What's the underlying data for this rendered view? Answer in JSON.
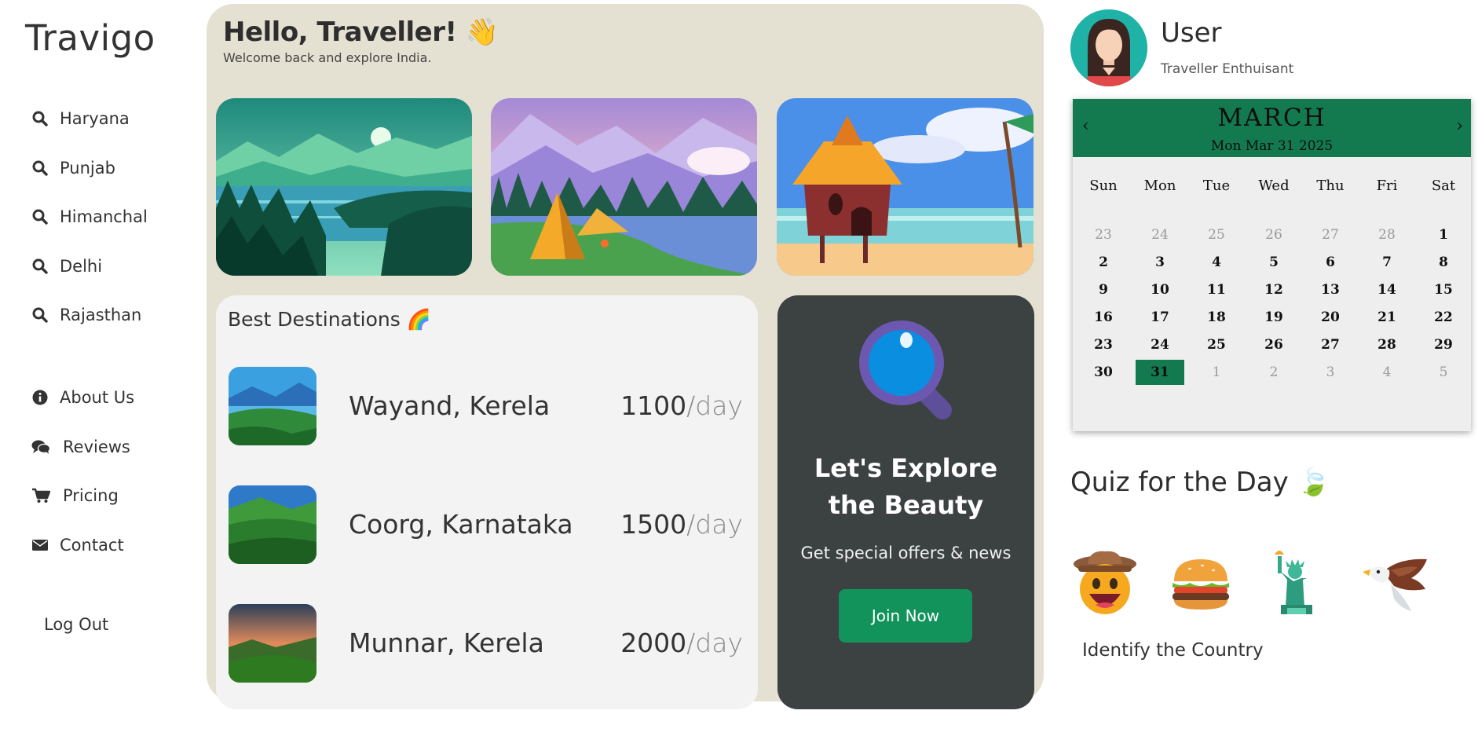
{
  "brand": "Travigo",
  "sidebar": {
    "destinations": [
      {
        "label": "Haryana",
        "icon": "search-icon"
      },
      {
        "label": "Punjab",
        "icon": "search-icon"
      },
      {
        "label": "Himanchal",
        "icon": "search-icon"
      },
      {
        "label": "Delhi",
        "icon": "search-icon"
      },
      {
        "label": "Rajasthan",
        "icon": "search-icon"
      }
    ],
    "links": [
      {
        "label": "About Us",
        "icon": "info-icon"
      },
      {
        "label": "Reviews",
        "icon": "comments-icon"
      },
      {
        "label": "Pricing",
        "icon": "cart-icon"
      },
      {
        "label": "Contact",
        "icon": "envelope-icon"
      }
    ],
    "logout": "Log Out"
  },
  "header": {
    "greeting": "Hello, Traveller! 👋",
    "subtitle": "Welcome back and explore India."
  },
  "best": {
    "title": "Best Destinations 🌈",
    "items": [
      {
        "name": "Wayand, Kerela",
        "price": "1100",
        "unit": "/day"
      },
      {
        "name": "Coorg, Karnataka",
        "price": "1500",
        "unit": "/day"
      },
      {
        "name": "Munnar, Kerela",
        "price": "2000",
        "unit": "/day"
      }
    ]
  },
  "explore": {
    "title_line1": "Let's Explore",
    "title_line2": "the Beauty",
    "text": "Get special offers & news",
    "button": "Join Now"
  },
  "user": {
    "name": "User",
    "role": "Traveller Enthuisant"
  },
  "calendar": {
    "month": "MARCH",
    "date": "Mon Mar 31 2025",
    "prev": "‹",
    "next": "›",
    "weekdays": [
      "Sun",
      "Mon",
      "Tue",
      "Wed",
      "Thu",
      "Fri",
      "Sat"
    ],
    "selected_day": 31,
    "weeks": [
      [
        {
          "d": "23",
          "m": true
        },
        {
          "d": "24",
          "m": true
        },
        {
          "d": "25",
          "m": true
        },
        {
          "d": "26",
          "m": true
        },
        {
          "d": "27",
          "m": true
        },
        {
          "d": "28",
          "m": true
        },
        {
          "d": "1"
        }
      ],
      [
        {
          "d": "2"
        },
        {
          "d": "3"
        },
        {
          "d": "4"
        },
        {
          "d": "5"
        },
        {
          "d": "6"
        },
        {
          "d": "7"
        },
        {
          "d": "8"
        }
      ],
      [
        {
          "d": "9"
        },
        {
          "d": "10"
        },
        {
          "d": "11"
        },
        {
          "d": "12"
        },
        {
          "d": "13"
        },
        {
          "d": "14"
        },
        {
          "d": "15"
        }
      ],
      [
        {
          "d": "16"
        },
        {
          "d": "17"
        },
        {
          "d": "18"
        },
        {
          "d": "19"
        },
        {
          "d": "20"
        },
        {
          "d": "21"
        },
        {
          "d": "22"
        }
      ],
      [
        {
          "d": "23"
        },
        {
          "d": "24"
        },
        {
          "d": "25"
        },
        {
          "d": "26"
        },
        {
          "d": "27"
        },
        {
          "d": "28"
        },
        {
          "d": "29"
        }
      ],
      [
        {
          "d": "30"
        },
        {
          "d": "31",
          "s": true
        },
        {
          "d": "1",
          "m": true
        },
        {
          "d": "2",
          "m": true
        },
        {
          "d": "3",
          "m": true
        },
        {
          "d": "4",
          "m": true
        },
        {
          "d": "5",
          "m": true
        }
      ]
    ]
  },
  "quiz": {
    "title": "Quiz for the Day 🍃",
    "icons": [
      "cowboy-face-icon",
      "burger-icon",
      "statue-of-liberty-icon",
      "eagle-icon"
    ],
    "caption": "Identify the Country"
  },
  "colors": {
    "panel": "#e4e0d2",
    "card": "#f3f3f3",
    "dark_card": "#3c4142",
    "accent_green": "#12935b",
    "calendar_green": "#137a50",
    "avatar_teal": "#1eb3a6"
  }
}
